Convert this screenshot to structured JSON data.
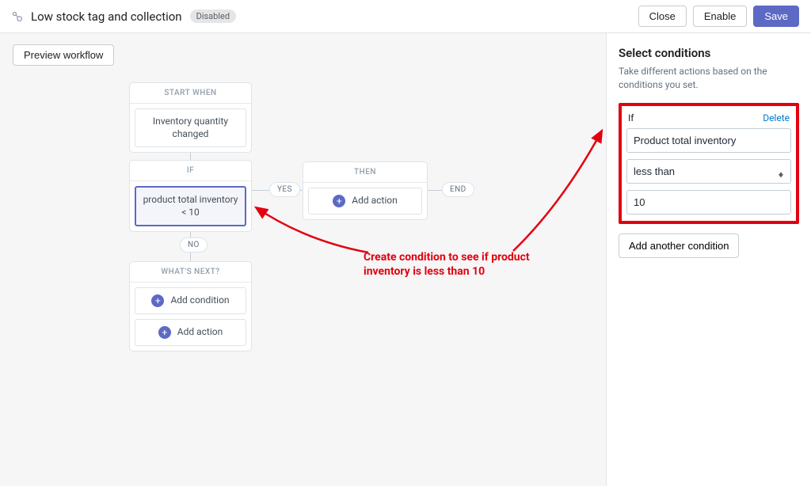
{
  "header": {
    "title": "Low stock tag and collection",
    "status": "Disabled",
    "close": "Close",
    "enable": "Enable",
    "save": "Save"
  },
  "toolbar": {
    "preview": "Preview workflow"
  },
  "nodes": {
    "start": {
      "head": "START WHEN",
      "body": "Inventory quantity changed"
    },
    "if": {
      "head": "IF",
      "body": "product total inventory < 10"
    },
    "then": {
      "head": "THEN",
      "action": "Add action"
    },
    "next": {
      "head": "WHAT'S NEXT?",
      "add_condition": "Add condition",
      "add_action": "Add action"
    }
  },
  "labels": {
    "yes": "YES",
    "no": "NO",
    "end": "END"
  },
  "sidebar": {
    "title": "Select conditions",
    "subtitle": "Take different actions based on the conditions you set.",
    "if_label": "If",
    "delete": "Delete",
    "field_value": "Product total inventory",
    "operator_value": "less than",
    "value_value": "10",
    "add_another": "Add another condition"
  },
  "annotation": {
    "text1": "Create condition to see if product",
    "text2": "inventory is less than 10"
  }
}
